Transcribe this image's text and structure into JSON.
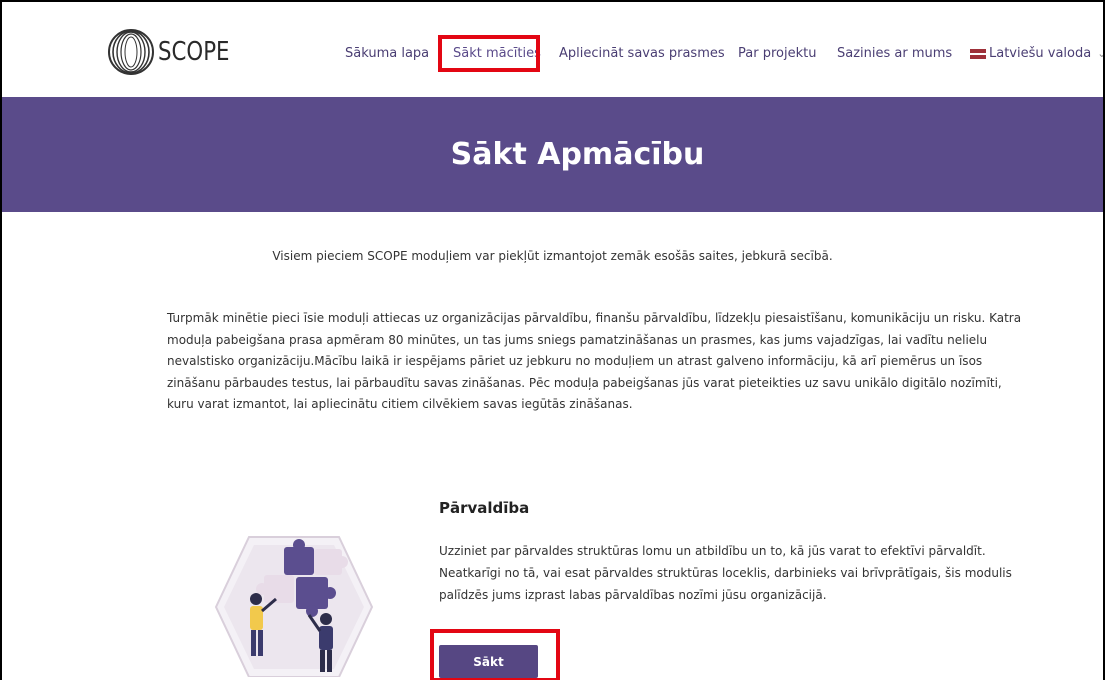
{
  "logo": {
    "text": "SCOPE"
  },
  "nav": {
    "items": [
      {
        "label": "Sākuma lapa"
      },
      {
        "label": "Sākt mācīties"
      },
      {
        "label": "Apliecināt savas prasmes"
      },
      {
        "label": "Par projektu"
      },
      {
        "label": "Sazinies ar mums"
      }
    ],
    "language": "Latviešu valoda"
  },
  "banner": {
    "title": "Sākt Apmācību"
  },
  "intro": "Visiem pieciem SCOPE moduļiem var piekļūt izmantojot zemāk esošās saites, jebkurā secībā.",
  "body": "Turpmāk minētie pieci īsie moduļi attiecas uz organizācijas pārvaldību, finanšu pārvaldību, līdzekļu piesaistīšanu, komunikāciju un risku. Katra moduļa pabeigšana prasa apmēram 80 minūtes, un tas jums sniegs pamatzināšanas un prasmes, kas jums vajadzīgas, lai vadītu nelielu nevalstisko organizāciju.Mācību laikā ir iespējams pāriet uz jebkuru no moduļiem un atrast galveno informāciju, kā arī piemērus un īsos zināšanu pārbaudes testus, lai pārbaudītu savas zināšanas. Pēc moduļa pabeigšanas jūs varat pieteikties uz savu unikālo digitālo nozīmīti, kuru varat izmantot, lai apliecinātu citiem cilvēkiem savas iegūtās zināšanas.",
  "module": {
    "title": "Pārvaldība",
    "description": "Uzziniet par pārvaldes struktūras lomu un atbildību un to, kā jūs varat to efektīvi pārvaldīt. Neatkarīgi no tā, vai esat pārvaldes struktūras loceklis, darbinieks vai brīvprātīgais, šis modulis palīdzēs jums izprast labas pārvaldības nozīmi jūsu organizācijā.",
    "button": "Sākt"
  },
  "colors": {
    "brand_purple": "#5a4b8a",
    "highlight_red": "#e30613"
  }
}
